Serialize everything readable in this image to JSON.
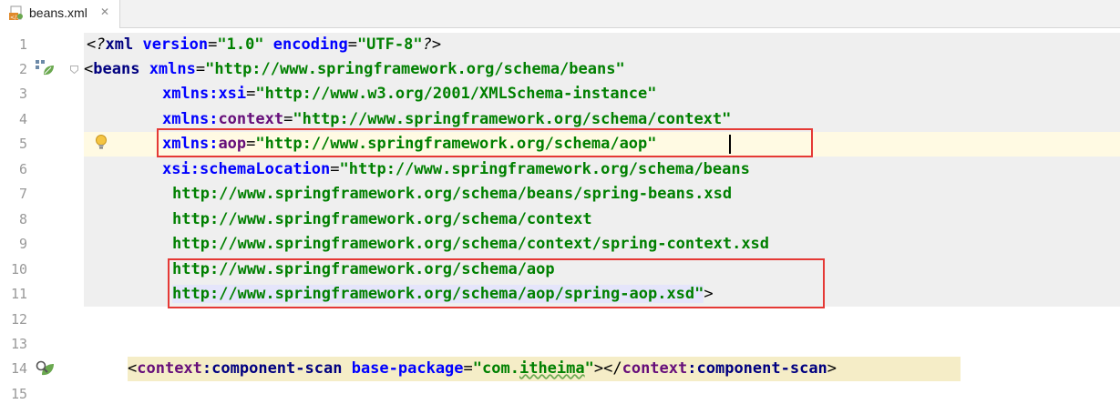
{
  "tab": {
    "filename": "beans.xml",
    "close_glyph": "✕",
    "icon": "xml-file-icon"
  },
  "colors": {
    "tag": "#000080",
    "attribute": "#0000ff",
    "namespace": "#660e7a",
    "string": "#008000",
    "line_number": "#999999",
    "highlight_box": "#e53935",
    "caret_line": "#fffae3",
    "tag_block": "#efefef"
  },
  "line_numbers": [
    "1",
    "2",
    "3",
    "4",
    "5",
    "6",
    "7",
    "8",
    "9",
    "10",
    "11",
    "12",
    "13",
    "14",
    "15"
  ],
  "code": {
    "l1": {
      "decl_open": "<?",
      "tag": "xml",
      "a1": "version",
      "eq1": "=",
      "v1": "\"1.0\"",
      "a2": "encoding",
      "eq2": "=",
      "v2": "\"UTF-8\"",
      "decl_close": "?>"
    },
    "l2": {
      "open": "<",
      "tag": "beans",
      "attr": "xmlns",
      "eq": "=",
      "val": "\"http://www.springframework.org/schema/beans\""
    },
    "l3": {
      "ns": "xmlns",
      "colon": ":",
      "attr": "xsi",
      "eq": "=",
      "val": "\"http://www.w3.org/2001/XMLSchema-instance\""
    },
    "l4": {
      "ns": "xmlns",
      "colon": ":",
      "attr": "context",
      "eq": "=",
      "val": "\"http://www.springframework.org/schema/context\""
    },
    "l5": {
      "ns": "xmlns",
      "colon": ":",
      "attr": "aop",
      "eq": "=",
      "val_a": "\"http://www.springframework.org/schema/aop",
      "val_b": "\""
    },
    "l6": {
      "ns": "xsi",
      "colon": ":",
      "attr": "schemaLocation",
      "eq": "=",
      "val": "\"http://www.springframework.org/schema/beans"
    },
    "l7": {
      "val": "http://www.springframework.org/schema/beans/spring-beans.xsd"
    },
    "l8": {
      "val": "http://www.springframework.org/schema/context"
    },
    "l9": {
      "val": "http://www.springframework.org/schema/context/spring-context.xsd"
    },
    "l10": {
      "val": "http://www.springframework.org/schema/aop"
    },
    "l11": {
      "val": "http://www.springframework.org/schema/aop/spring-aop.xsd\"",
      "close": ">"
    },
    "l14": {
      "lt": "<",
      "ns": "context",
      "colon": ":",
      "tag": "component-scan",
      "attr": "base-package",
      "eq": "=",
      "val_a": "\"com.",
      "val_typo": "itheima",
      "val_b": "\"",
      "gt": "></",
      "ns2": "context",
      "colon2": ":",
      "tag2": "component-scan",
      "end": ">"
    }
  }
}
